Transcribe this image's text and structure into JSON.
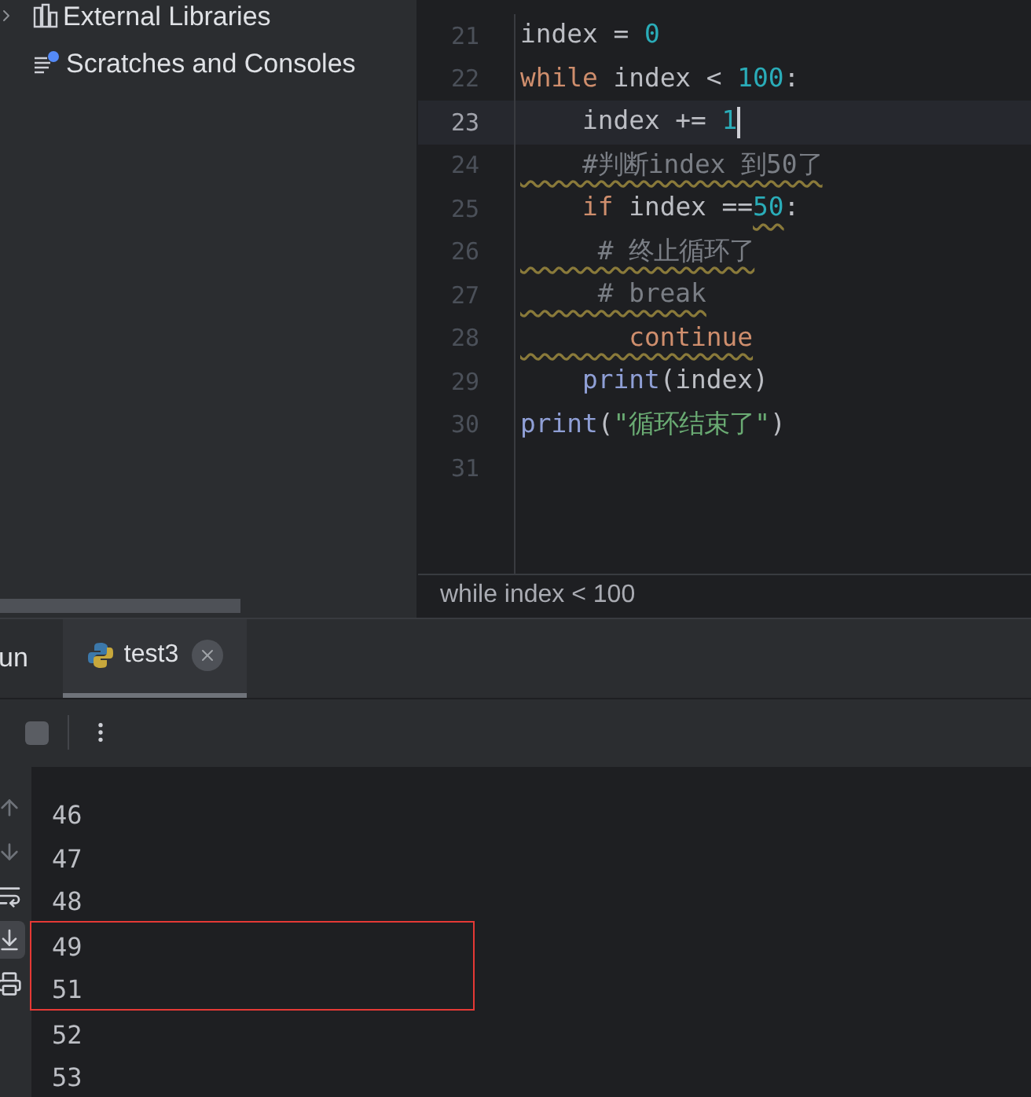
{
  "project_tree": [
    {
      "label": "External Libraries",
      "kind": "library",
      "expandable": true
    },
    {
      "label": "Scratches and Consoles",
      "kind": "scratches",
      "expandable": false
    }
  ],
  "editor": {
    "lines": [
      {
        "number": "21",
        "current": false,
        "tokens": [
          {
            "text": "index = ",
            "kind": "plain"
          },
          {
            "text": "0",
            "kind": "number"
          }
        ]
      },
      {
        "number": "22",
        "current": false,
        "tokens": [
          {
            "text": "while",
            "kind": "keyword"
          },
          {
            "text": " index < ",
            "kind": "plain"
          },
          {
            "text": "100",
            "kind": "number"
          },
          {
            "text": ":",
            "kind": "plain"
          }
        ]
      },
      {
        "number": "23",
        "current": true,
        "tokens": [
          {
            "text": "    index += ",
            "kind": "plain"
          },
          {
            "text": "1",
            "kind": "number"
          }
        ]
      },
      {
        "number": "24",
        "current": false,
        "tokens": [
          {
            "text": "    #判断index 到50了",
            "kind": "comment",
            "squiggle": true
          }
        ]
      },
      {
        "number": "25",
        "current": false,
        "tokens": [
          {
            "text": "    if",
            "kind": "keyword",
            "squiggle": false
          },
          {
            "text": " index ==",
            "kind": "plain",
            "squiggle": false
          },
          {
            "text": "50",
            "kind": "number",
            "squiggle": true
          },
          {
            "text": ":",
            "kind": "plain",
            "squiggle": false
          }
        ]
      },
      {
        "number": "26",
        "current": false,
        "tokens": [
          {
            "text": "     # 终止循环了",
            "kind": "comment",
            "squiggle": true
          }
        ]
      },
      {
        "number": "27",
        "current": false,
        "tokens": [
          {
            "text": "     # break",
            "kind": "comment",
            "squiggle": true
          }
        ]
      },
      {
        "number": "28",
        "current": false,
        "tokens": [
          {
            "text": "       continue",
            "kind": "keyword",
            "squiggle": true
          }
        ]
      },
      {
        "number": "29",
        "current": false,
        "tokens": [
          {
            "text": "    print",
            "kind": "builtin"
          },
          {
            "text": "(index)",
            "kind": "plain"
          }
        ]
      },
      {
        "number": "30",
        "current": false,
        "tokens": [
          {
            "text": "print",
            "kind": "builtin"
          },
          {
            "text": "(",
            "kind": "plain"
          },
          {
            "text": "\"循环结束了\"",
            "kind": "string"
          },
          {
            "text": ")",
            "kind": "plain"
          }
        ]
      },
      {
        "number": "31",
        "current": false
      }
    ],
    "breadcrumb": "while index < 100"
  },
  "run_panel": {
    "title": "un",
    "tabs": [
      {
        "label": "test3",
        "selected": true,
        "closable": true
      }
    ],
    "side_tools": [
      {
        "kind": "up",
        "selected": false
      },
      {
        "kind": "down",
        "selected": false
      },
      {
        "kind": "wrap",
        "selected": false
      },
      {
        "kind": "scroll-end",
        "selected": true
      },
      {
        "kind": "print",
        "selected": false
      }
    ],
    "output": [
      {
        "text": "46",
        "boxed": false
      },
      {
        "text": "47",
        "boxed": false
      },
      {
        "text": "48",
        "boxed": false
      },
      {
        "text": "49",
        "boxed": true
      },
      {
        "text": "51",
        "boxed": true
      },
      {
        "text": "52",
        "boxed": false
      },
      {
        "text": "53",
        "boxed": false
      }
    ]
  }
}
